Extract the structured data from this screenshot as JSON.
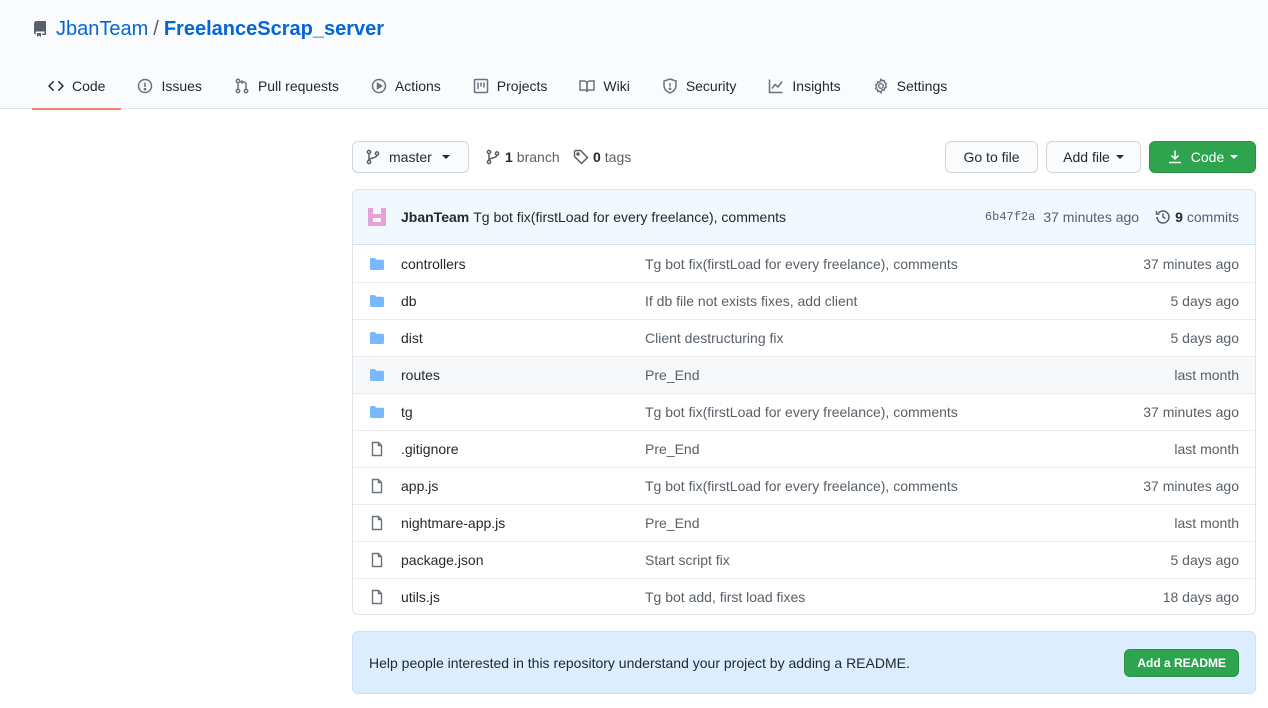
{
  "repo": {
    "owner": "JbanTeam",
    "separator": "/",
    "name": "FreelanceScrap_server"
  },
  "tabs": [
    {
      "label": "Code",
      "icon": "code-icon",
      "selected": true
    },
    {
      "label": "Issues",
      "icon": "issue-icon",
      "selected": false
    },
    {
      "label": "Pull requests",
      "icon": "pull-request-icon",
      "selected": false
    },
    {
      "label": "Actions",
      "icon": "play-icon",
      "selected": false
    },
    {
      "label": "Projects",
      "icon": "project-icon",
      "selected": false
    },
    {
      "label": "Wiki",
      "icon": "book-icon",
      "selected": false
    },
    {
      "label": "Security",
      "icon": "shield-icon",
      "selected": false
    },
    {
      "label": "Insights",
      "icon": "graph-icon",
      "selected": false
    },
    {
      "label": "Settings",
      "icon": "gear-icon",
      "selected": false
    }
  ],
  "toolbar": {
    "branch_name": "master",
    "branch_count": "1",
    "branch_label": "branch",
    "tag_count": "0",
    "tag_label": "tags",
    "go_to_file": "Go to file",
    "add_file": "Add file",
    "code": "Code"
  },
  "commit": {
    "author": "JbanTeam",
    "message": "Tg bot fix(firstLoad for every freelance), comments",
    "sha": "6b47f2a",
    "time": "37 minutes ago",
    "commit_count": "9",
    "commit_label": "commits"
  },
  "files": [
    {
      "name": "controllers",
      "type": "dir",
      "commit": "Tg bot fix(firstLoad for every freelance), comments",
      "age": "37 minutes ago"
    },
    {
      "name": "db",
      "type": "dir",
      "commit": "If db file not exists fixes, add client",
      "age": "5 days ago"
    },
    {
      "name": "dist",
      "type": "dir",
      "commit": "Client destructuring fix",
      "age": "5 days ago"
    },
    {
      "name": "routes",
      "type": "dir",
      "commit": "Pre_End",
      "age": "last month"
    },
    {
      "name": "tg",
      "type": "dir",
      "commit": "Tg bot fix(firstLoad for every freelance), comments",
      "age": "37 minutes ago"
    },
    {
      "name": ".gitignore",
      "type": "file",
      "commit": "Pre_End",
      "age": "last month"
    },
    {
      "name": "app.js",
      "type": "file",
      "commit": "Tg bot fix(firstLoad for every freelance), comments",
      "age": "37 minutes ago"
    },
    {
      "name": "nightmare-app.js",
      "type": "file",
      "commit": "Pre_End",
      "age": "last month"
    },
    {
      "name": "package.json",
      "type": "file",
      "commit": "Start script fix",
      "age": "5 days ago"
    },
    {
      "name": "utils.js",
      "type": "file",
      "commit": "Tg bot add, first load fixes",
      "age": "18 days ago"
    }
  ],
  "readme": {
    "text": "Help people interested in this repository understand your project by adding a README.",
    "button": "Add a README"
  },
  "colors": {
    "link": "#0366d6",
    "green": "#2ea44f",
    "folder": "#79b8ff",
    "tab_underline": "#f9826c"
  }
}
